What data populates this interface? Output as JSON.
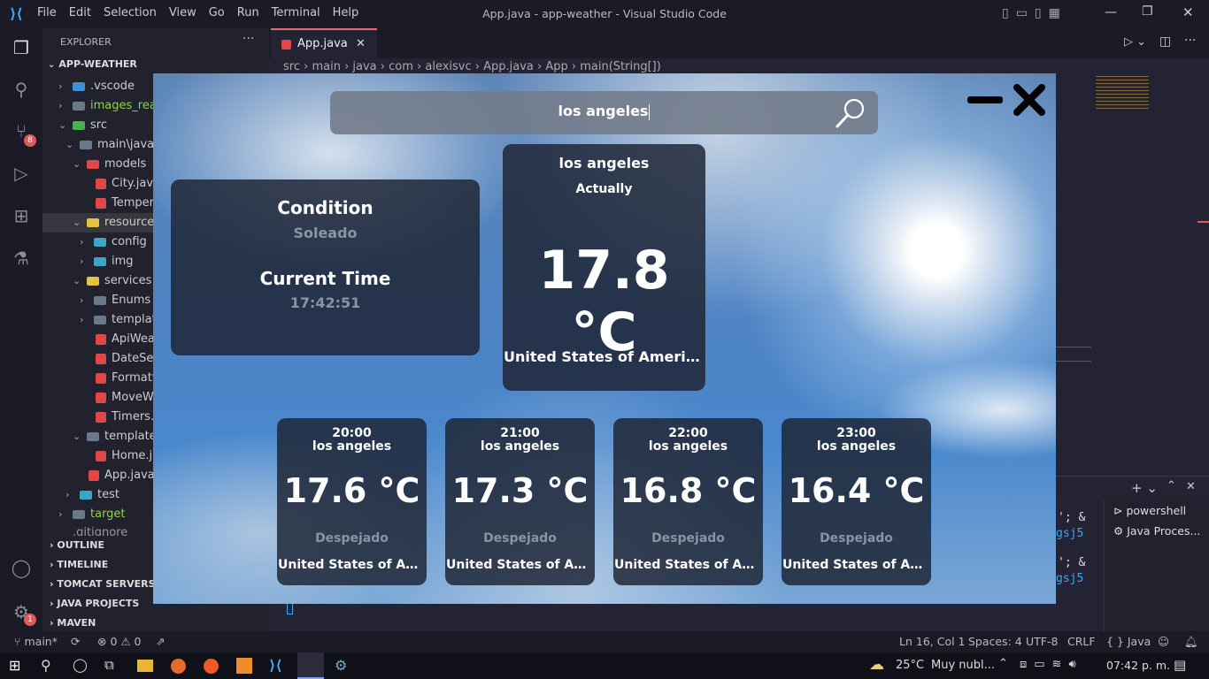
{
  "vscode": {
    "menu": [
      "File",
      "Edit",
      "Selection",
      "View",
      "Go",
      "Run",
      "Terminal",
      "Help"
    ],
    "window_title": "App.java - app-weather - Visual Studio Code",
    "explorer_label": "EXPLORER",
    "project": "APP-WEATHER",
    "tree": [
      {
        "label": ".vscode",
        "type": "folder"
      },
      {
        "label": "images_read",
        "type": "folder"
      },
      {
        "label": "src",
        "type": "folder"
      },
      {
        "label": "main\\java",
        "type": "folder"
      },
      {
        "label": "models",
        "type": "folder"
      },
      {
        "label": "City.java",
        "type": "file"
      },
      {
        "label": "Tempera",
        "type": "file"
      },
      {
        "label": "resources",
        "type": "folder"
      },
      {
        "label": "config",
        "type": "folder"
      },
      {
        "label": "img",
        "type": "folder"
      },
      {
        "label": "services",
        "type": "folder"
      },
      {
        "label": "Enums",
        "type": "folder"
      },
      {
        "label": "templat",
        "type": "folder"
      },
      {
        "label": "ApiWea",
        "type": "file"
      },
      {
        "label": "DateSer",
        "type": "file"
      },
      {
        "label": "Formatt",
        "type": "file"
      },
      {
        "label": "MoveW",
        "type": "file"
      },
      {
        "label": "Timers.j",
        "type": "file"
      },
      {
        "label": "templates",
        "type": "folder"
      },
      {
        "label": "Home.ja",
        "type": "file"
      },
      {
        "label": "App.java",
        "type": "file"
      },
      {
        "label": "test",
        "type": "folder"
      },
      {
        "label": "target",
        "type": "folder"
      },
      {
        "label": ".gitignore",
        "type": "file"
      }
    ],
    "sections": [
      "OUTLINE",
      "TIMELINE",
      "TOMCAT SERVERS",
      "JAVA PROJECTS",
      "MAVEN"
    ],
    "scm_badge": "8",
    "settings_badge": "1",
    "tab_label": "App.java",
    "breadcrumbs": [
      "src",
      "main",
      "java",
      "com",
      "alexisvc",
      "App.java",
      "App",
      "main(String[])"
    ],
    "terminal_items": [
      "powershell",
      "Java Proces..."
    ],
    "terminal_snippets": [
      "'; &",
      "gsj5",
      "'; &",
      "gsj5"
    ],
    "status": {
      "branch": "main*",
      "problems": "⊗ 0 ⚠ 0",
      "position": "Ln 16, Col 1",
      "spaces": "Spaces: 4",
      "encoding": "UTF-8",
      "eol": "CRLF",
      "language": "{ } Java"
    },
    "taskbar": {
      "weather_temp": "25°C",
      "weather_text": "Muy nubl...",
      "time": "07:42 p. m."
    }
  },
  "app": {
    "search": {
      "value": "los angeles"
    },
    "window_controls": {
      "minimize": "−",
      "close": "✕"
    },
    "info_card": {
      "condition_label": "Condition",
      "condition_value": "Soleado",
      "time_label": "Current Time",
      "time_value": "17:42:51"
    },
    "current": {
      "city": "los angeles",
      "subtitle": "Actually",
      "temperature": "17.8 °C",
      "country": "United States of America, Ca..."
    },
    "hourly": [
      {
        "time": "20:00",
        "city": "los angeles",
        "temperature": "17.6 °C",
        "condition": "Despejado",
        "country": "United States of Ameri..."
      },
      {
        "time": "21:00",
        "city": "los angeles",
        "temperature": "17.3 °C",
        "condition": "Despejado",
        "country": "United States of Ameri..."
      },
      {
        "time": "22:00",
        "city": "los angeles",
        "temperature": "16.8 °C",
        "condition": "Despejado",
        "country": "United States of Ameri..."
      },
      {
        "time": "23:00",
        "city": "los angeles",
        "temperature": "16.4 °C",
        "condition": "Despejado",
        "country": "United States of Ameri..."
      }
    ]
  },
  "colors": {
    "accent": "#4fc1ff",
    "card_bg": "#1e2534",
    "sky": "#4e83c4"
  }
}
